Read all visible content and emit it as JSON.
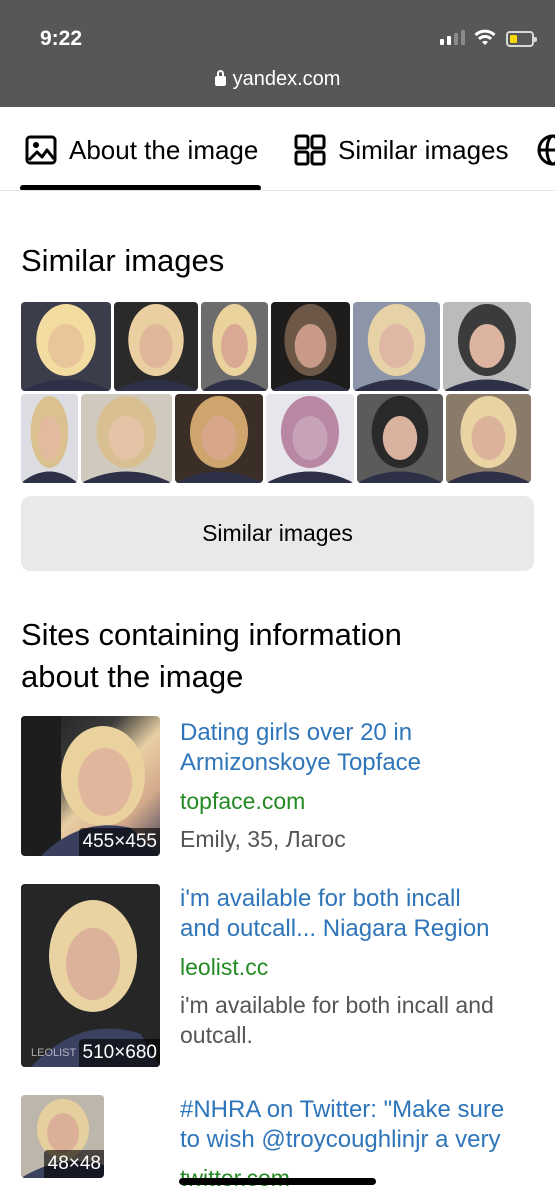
{
  "status_bar": {
    "time": "9:22"
  },
  "url_bar": {
    "domain": "yandex.com"
  },
  "tabs": [
    {
      "label": "About the image",
      "icon": "image-icon",
      "active": true
    },
    {
      "label": "Similar images",
      "icon": "grid-icon"
    },
    {
      "label": "",
      "icon": "globe-icon"
    }
  ],
  "similar": {
    "heading": "Similar images",
    "button_label": "Similar images",
    "thumbnails_row1": [
      {
        "icon": "photo-thumbnail",
        "colors": [
          "#3b3d4a",
          "#e8c59a",
          "#f3dca0"
        ]
      },
      {
        "icon": "photo-thumbnail",
        "colors": [
          "#2a2a2a",
          "#e1b79b",
          "#ead0a0"
        ]
      },
      {
        "icon": "photo-thumbnail",
        "colors": [
          "#6c6c6c",
          "#d9a994",
          "#e9d29c"
        ]
      },
      {
        "icon": "photo-thumbnail",
        "colors": [
          "#1f1c1c",
          "#c99a88",
          "#6d5848"
        ]
      },
      {
        "icon": "photo-thumbnail",
        "colors": [
          "#8d95a8",
          "#dfb7a4",
          "#e6d2a6"
        ]
      },
      {
        "icon": "photo-thumbnail",
        "colors": [
          "#bbbbbb",
          "#dcb4a0",
          "#3b3b3b"
        ]
      }
    ],
    "thumbnails_row2": [
      {
        "icon": "photo-thumbnail",
        "colors": [
          "#dcdde2",
          "#e3ba9e",
          "#dbc090"
        ]
      },
      {
        "icon": "photo-thumbnail",
        "colors": [
          "#cfc9be",
          "#e5c3a6",
          "#d8c092"
        ]
      },
      {
        "icon": "photo-thumbnail",
        "colors": [
          "#3a2e26",
          "#d8a688",
          "#cfa56e"
        ]
      },
      {
        "icon": "photo-thumbnail",
        "colors": [
          "#e6e6ec",
          "#c6a3b9",
          "#b987a4"
        ]
      },
      {
        "icon": "photo-thumbnail",
        "colors": [
          "#5b5b5b",
          "#d9b39f",
          "#2a2a2a"
        ]
      },
      {
        "icon": "photo-thumbnail",
        "colors": [
          "#8a7a6a",
          "#dcb39a",
          "#e9d3a3"
        ]
      }
    ]
  },
  "sites": {
    "heading_line1": "Sites containing information",
    "heading_line2": "about the image",
    "results": [
      {
        "title_line1": "Dating girls over 20 in",
        "title_line2": "Armizonskoye Topface",
        "site": "topface.com",
        "description": "Emily, 35, Лагос",
        "size": "455×455"
      },
      {
        "title_line1": "i'm available for both incall",
        "title_line2": "and outcall... Niagara Region",
        "site": "leolist.cc",
        "description": "i'm available for both incall and outcall.",
        "size": "510×680",
        "watermark": "LEOLIST"
      },
      {
        "title_line1": "#NHRA on Twitter: \"Make sure",
        "title_line2": "to wish @troycoughlinjr a very",
        "site": "twitter.com",
        "size": "48×48"
      }
    ]
  },
  "colors": {
    "topbar": "#575757",
    "link": "#2f75b9",
    "site": "#248a23",
    "button_bg": "#e9e9e9"
  }
}
